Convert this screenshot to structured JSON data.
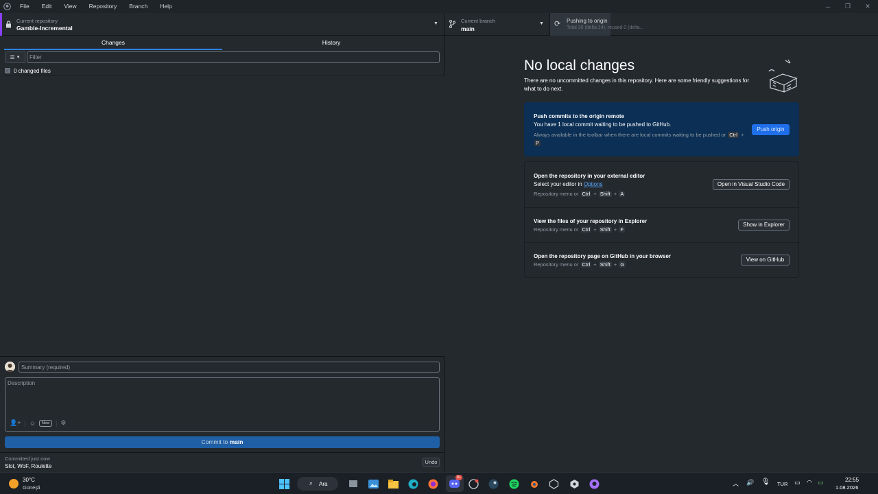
{
  "menubar": {
    "items": [
      "File",
      "Edit",
      "View",
      "Repository",
      "Branch",
      "Help"
    ]
  },
  "toolbar": {
    "repo_label": "Current repository",
    "repo_name": "Gamble-Incremental",
    "branch_label": "Current branch",
    "branch_name": "main",
    "push_title": "Pushing to origin",
    "push_status": "Total 30 (delta 14), reused 0 (delta..."
  },
  "left": {
    "tabs": [
      "Changes",
      "History"
    ],
    "filter_placeholder": "Filter",
    "changed_files": "0 changed files",
    "summary_placeholder": "Summary (required)",
    "description_placeholder": "Description",
    "new_badge": "New",
    "commit_prefix": "Commit to",
    "commit_branch": "main",
    "last_commit_time": "Committed just now",
    "last_commit_message": "Slot, WoF, Roulette",
    "undo_label": "Undo"
  },
  "right": {
    "title": "No local changes",
    "description": "There are no uncommitted changes in this repository. Here are some friendly suggestions for what to do next.",
    "push_card": {
      "title": "Push commits to the origin remote",
      "subtitle": "You have 1 local commit waiting to be pushed to GitHub.",
      "hint": "Always available in the toolbar when there are local commits waiting to be pushed or",
      "keys": [
        "Ctrl",
        "P"
      ],
      "button": "Push origin"
    },
    "editor_row": {
      "title": "Open the repository in your external editor",
      "subtitle_prefix": "Select your editor in",
      "subtitle_link": "Options",
      "hint": "Repository menu or",
      "keys": [
        "Ctrl",
        "Shift",
        "A"
      ],
      "button": "Open in Visual Studio Code"
    },
    "explorer_row": {
      "title": "View the files of your repository in Explorer",
      "hint": "Repository menu or",
      "keys": [
        "Ctrl",
        "Shift",
        "F"
      ],
      "button": "Show in Explorer"
    },
    "github_row": {
      "title": "Open the repository page on GitHub in your browser",
      "hint": "Repository menu or",
      "keys": [
        "Ctrl",
        "Shift",
        "G"
      ],
      "button": "View on GitHub"
    }
  },
  "taskbar": {
    "weather_temp": "30°C",
    "weather_desc": "Güneşli",
    "search_label": "Ara",
    "discord_badge": "9+",
    "language": "TUR",
    "time": "22:55",
    "date": "1.08.2026"
  },
  "colors": {
    "accent": "#1f6feb",
    "repo_marker": "#8a3ffc",
    "background": "#24292e"
  }
}
